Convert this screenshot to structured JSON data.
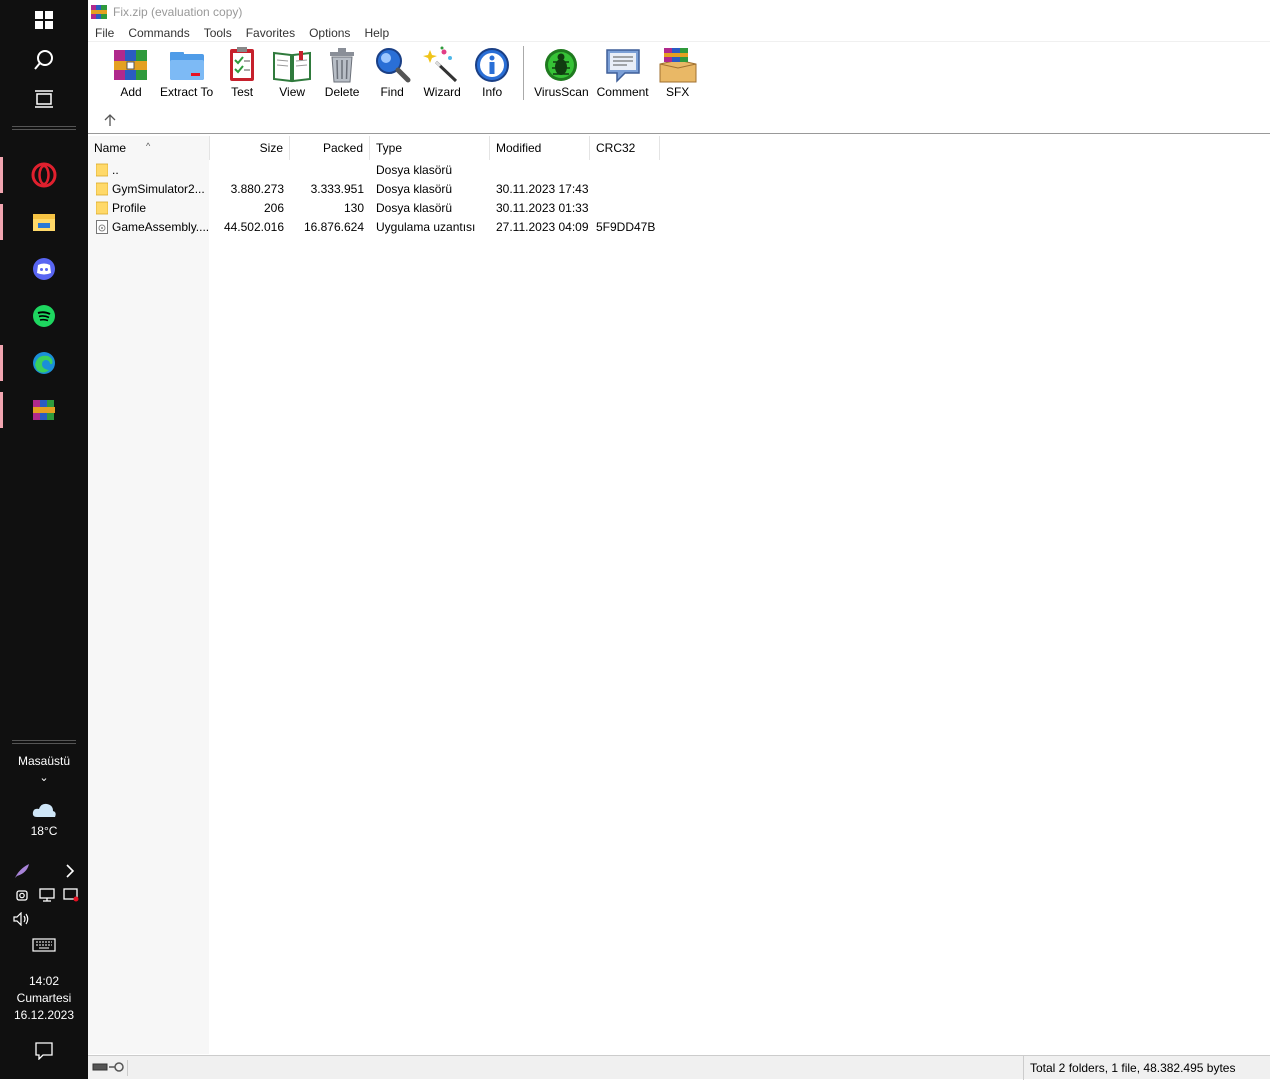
{
  "taskbar": {
    "desktop_label": "Masaüstü",
    "weather_temp": "18°C",
    "clock_time": "14:02",
    "clock_day": "Cumartesi",
    "clock_date": "16.12.2023"
  },
  "window": {
    "title": "Fix.zip (evaluation copy)"
  },
  "menu": [
    "File",
    "Commands",
    "Tools",
    "Favorites",
    "Options",
    "Help"
  ],
  "toolbar": {
    "add": "Add",
    "extract_to": "Extract To",
    "test": "Test",
    "view": "View",
    "delete": "Delete",
    "find": "Find",
    "wizard": "Wizard",
    "info": "Info",
    "virusscan": "VirusScan",
    "comment": "Comment",
    "sfx": "SFX"
  },
  "columns": {
    "name": "Name",
    "size": "Size",
    "packed": "Packed",
    "type": "Type",
    "modified": "Modified",
    "crc32": "CRC32"
  },
  "files": [
    {
      "name": "..",
      "size": "",
      "packed": "",
      "type": "Dosya klasörü",
      "modified": "",
      "crc32": ""
    },
    {
      "name": "GymSimulator2...",
      "size": "3.880.273",
      "packed": "3.333.951",
      "type": "Dosya klasörü",
      "modified": "30.11.2023 17:43",
      "crc32": ""
    },
    {
      "name": "Profile",
      "size": "206",
      "packed": "130",
      "type": "Dosya klasörü",
      "modified": "30.11.2023 01:33",
      "crc32": ""
    },
    {
      "name": "GameAssembly....",
      "size": "44.502.016",
      "packed": "16.876.624",
      "type": "Uygulama uzantısı",
      "modified": "27.11.2023 04:09",
      "crc32": "5F9DD47B"
    }
  ],
  "status": {
    "summary": "Total 2 folders, 1 file, 48.382.495 bytes"
  },
  "colors": {
    "taskbar_bg": "#101010",
    "active_indicator": "#f2a5b0",
    "folder": "#ffd969"
  }
}
